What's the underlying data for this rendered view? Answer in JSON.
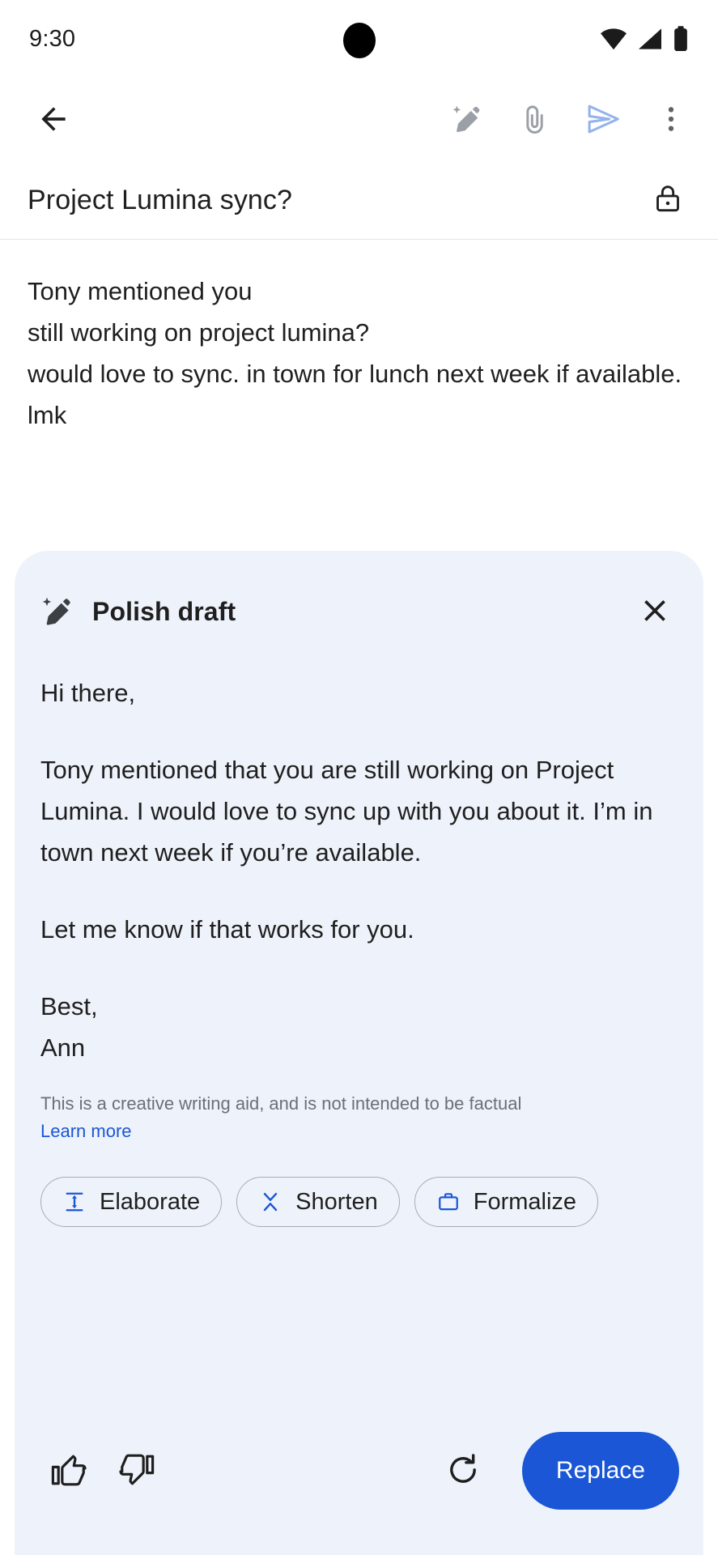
{
  "status_bar": {
    "time": "9:30",
    "icons": [
      "wifi-icon",
      "cellular-signal-icon",
      "battery-icon"
    ]
  },
  "app_bar": {
    "back_icon": "back-arrow-icon",
    "actions": [
      {
        "name": "polish-draft-icon",
        "label": "Polish draft"
      },
      {
        "name": "attach-icon",
        "label": "Attach file"
      },
      {
        "name": "send-icon",
        "label": "Send"
      },
      {
        "name": "more-options-icon",
        "label": "More options"
      }
    ]
  },
  "compose": {
    "subject": "Project Lumina sync?",
    "lock_icon": "lock-icon",
    "body_lines": [
      "Tony mentioned you",
      "still working on project lumina?",
      "would love to sync. in town for lunch next week if available. lmk"
    ]
  },
  "polish_card": {
    "title": "Polish draft",
    "title_icon": "magic-pencil-icon",
    "close_icon": "close-icon",
    "draft": {
      "greeting": "Hi there,",
      "paragraph": "Tony mentioned that you are still working on Project Lumina. I would love to sync up with you about it. I’m in town next week if you’re available.",
      "closing_line": "Let me know if that works for you.",
      "sign_off": "Best,",
      "signature": "Ann"
    },
    "disclaimer": {
      "text": "This is a creative writing aid, and is not intended to be factual",
      "link_label": "Learn more"
    },
    "chips": [
      {
        "label": "Elaborate",
        "icon": "expand-vertical-icon"
      },
      {
        "label": "Shorten",
        "icon": "collapse-vertical-icon"
      },
      {
        "label": "Formalize",
        "icon": "briefcase-icon"
      }
    ],
    "actions": {
      "thumb_up_icon": "thumb-up-icon",
      "thumb_down_icon": "thumb-down-icon",
      "refresh_icon": "refresh-icon",
      "replace_label": "Replace"
    }
  },
  "colors": {
    "accent_blue": "#1a56d6",
    "card_background": "#eef3fb",
    "send_icon_blue": "#94b3eb",
    "text_primary": "#1f1f1f",
    "text_secondary": "#6b6f76"
  }
}
